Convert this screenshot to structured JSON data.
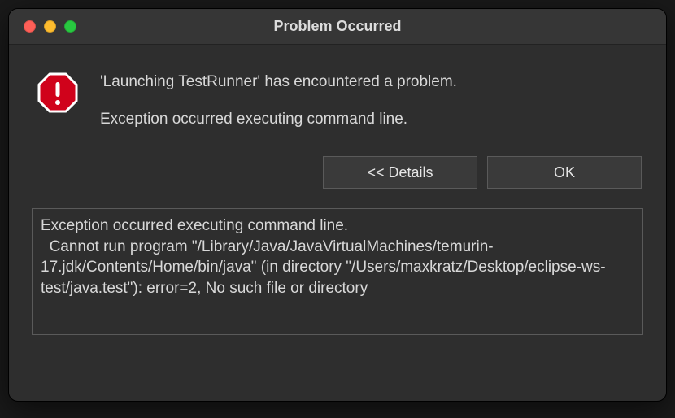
{
  "window": {
    "title": "Problem Occurred"
  },
  "message": {
    "heading": "'Launching TestRunner' has encountered a problem.",
    "summary": "Exception occurred executing command line."
  },
  "buttons": {
    "details": "<< Details",
    "ok": "OK"
  },
  "details": {
    "text": "Exception occurred executing command line.\n  Cannot run program \"/Library/Java/JavaVirtualMachines/temurin-17.jdk/Contents/Home/bin/java\" (in directory \"/Users/maxkratz/Desktop/eclipse-ws-test/java.test\"): error=2, No such file or directory"
  },
  "icons": {
    "error": "error-octagon"
  },
  "colors": {
    "error_fill": "#d0021b",
    "error_border": "#ffffff"
  }
}
